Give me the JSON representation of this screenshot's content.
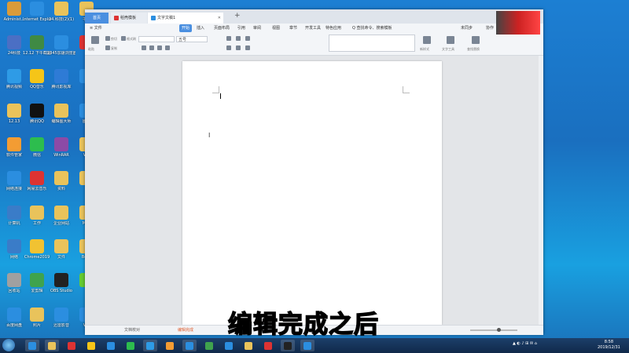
{
  "desktop": {
    "icons": [
      {
        "label": "Administ...",
        "color": "#d99b3a"
      },
      {
        "label": "Internet Explorer",
        "color": "#2b8ee0"
      },
      {
        "label": "24.科技(2)(1)",
        "color": "#e9c35b"
      },
      {
        "label": "书元",
        "color": "#e9c35b"
      },
      {
        "label": "24科技",
        "color": "#4b6fc4"
      },
      {
        "label": "12.12 下午截图",
        "color": "#3f8a43"
      },
      {
        "label": "2345加速浏览器",
        "color": "#2b8ee0"
      },
      {
        "label": "",
        "color": "#d33"
      },
      {
        "label": "腾讯视频",
        "color": "#2e9be6"
      },
      {
        "label": "QQ音乐",
        "color": "#f5c518"
      },
      {
        "label": "腾讯影视库",
        "color": "#2e7bd6"
      },
      {
        "label": "",
        "color": "#2b8ee0"
      },
      {
        "label": "12.13",
        "color": "#e9c35b"
      },
      {
        "label": "腾讯QQ",
        "color": "#111"
      },
      {
        "label": "编辑图大师",
        "color": "#e9c35b"
      },
      {
        "label": "图片",
        "color": "#2b8ee0"
      },
      {
        "label": "软件管家",
        "color": "#f39c33"
      },
      {
        "label": "微信",
        "color": "#2dbd4e"
      },
      {
        "label": "WinRAR",
        "color": "#8c4aa6"
      },
      {
        "label": "WP",
        "color": "#e9c35b"
      },
      {
        "label": "网络连接",
        "color": "#2b8ee0"
      },
      {
        "label": "网易云音乐",
        "color": "#d33"
      },
      {
        "label": "资料",
        "color": "#e9c35b"
      },
      {
        "label": "",
        "color": "#e9c35b"
      },
      {
        "label": "计算机",
        "color": "#3a7cc8"
      },
      {
        "label": "工作",
        "color": "#e9c35b"
      },
      {
        "label": "企业网站",
        "color": "#e9c35b"
      },
      {
        "label": "Micr",
        "color": "#e9c35b"
      },
      {
        "label": "网络",
        "color": "#3a7cc8"
      },
      {
        "label": "Chrome2019",
        "color": "#f1c232"
      },
      {
        "label": "文件",
        "color": "#e9c35b"
      },
      {
        "label": "Beac",
        "color": "#e9c35b"
      },
      {
        "label": "回收站",
        "color": "#a0a0a0"
      },
      {
        "label": "爱剪辑",
        "color": "#3fa34d"
      },
      {
        "label": "OBS Studio",
        "color": "#222"
      },
      {
        "label": "",
        "color": "#6c3"
      },
      {
        "label": "百度网盘",
        "color": "#2b8ee0"
      },
      {
        "label": "照片",
        "color": "#e9c35b"
      },
      {
        "label": "迅雷影音",
        "color": "#2b8ee0"
      },
      {
        "label": "WP",
        "color": "#2b8ee0"
      }
    ]
  },
  "window": {
    "tabs": [
      {
        "label": "首页"
      },
      {
        "label": "稻壳模板"
      },
      {
        "label": "文字文稿1"
      }
    ],
    "new_tab": "+",
    "menu": [
      {
        "label": "≡ 文件",
        "active": false
      },
      {
        "label": "开始",
        "active": true
      },
      {
        "label": "插入",
        "active": false
      },
      {
        "label": "页面布局",
        "active": false
      },
      {
        "label": "引用",
        "active": false
      },
      {
        "label": "审阅",
        "active": false
      },
      {
        "label": "视图",
        "active": false
      },
      {
        "label": "章节",
        "active": false
      },
      {
        "label": "开发工具",
        "active": false
      },
      {
        "label": "特色应用",
        "active": false
      },
      {
        "label": "Q 查找命令、搜索模板",
        "active": false
      }
    ],
    "sync": "未同步",
    "collab": "协作",
    "share": "分享",
    "font_name": "",
    "font_size": "五号",
    "ribbon_labels": [
      "粘贴",
      "剪切",
      "复制",
      "格式刷",
      "新样式",
      "文字工具",
      "查找替换"
    ],
    "statusbar": {
      "left": "文档校对",
      "right": "编辑完成"
    }
  },
  "subtitle": "编辑完成之后",
  "taskbar": {
    "apps": [
      {
        "color": "#2b8ee0",
        "open": true
      },
      {
        "color": "#e9c35b",
        "open": true
      },
      {
        "color": "#d33",
        "open": false
      },
      {
        "color": "#f5c518",
        "open": false
      },
      {
        "color": "#2b8ee0",
        "open": false
      },
      {
        "color": "#2dbd4e",
        "open": false
      },
      {
        "color": "#2e9be6",
        "open": true
      },
      {
        "color": "#f39c33",
        "open": false
      },
      {
        "color": "#2b8ee0",
        "open": true
      },
      {
        "color": "#3fa34d",
        "open": false
      },
      {
        "color": "#2b8ee0",
        "open": false
      },
      {
        "color": "#e9c35b",
        "open": false
      },
      {
        "color": "#d33",
        "open": false
      },
      {
        "color": "#222",
        "open": true
      },
      {
        "color": "#2b8ee0",
        "open": true
      }
    ],
    "clock_time": "8:58",
    "clock_date": "2019/12/31"
  }
}
